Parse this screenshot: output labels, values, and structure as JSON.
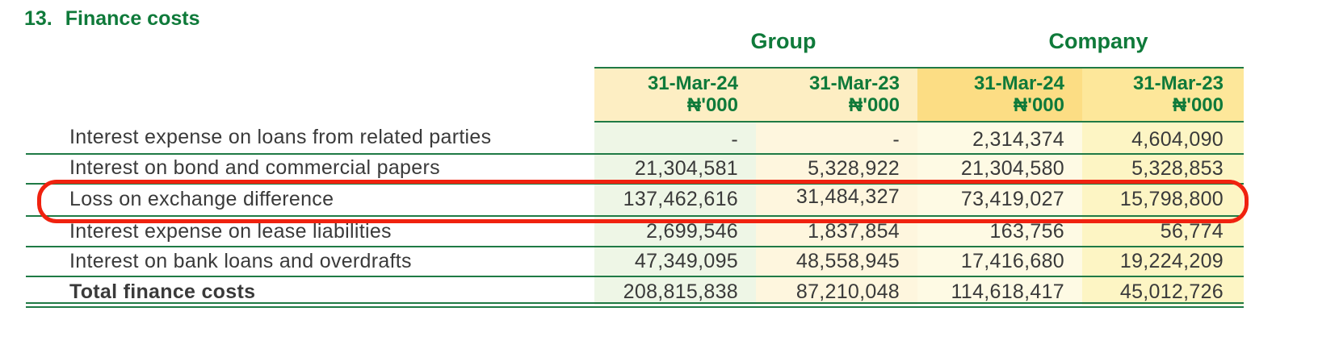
{
  "section": {
    "number": "13.",
    "title": "Finance costs"
  },
  "groups": [
    {
      "label": "Group"
    },
    {
      "label": "Company"
    }
  ],
  "columns": [
    {
      "date": "31-Mar-24",
      "unit": "₦'000"
    },
    {
      "date": "31-Mar-23",
      "unit": "₦'000"
    },
    {
      "date": "31-Mar-24",
      "unit": "₦'000"
    },
    {
      "date": "31-Mar-23",
      "unit": "₦'000"
    }
  ],
  "rows": [
    {
      "label": "Interest expense on loans from related parties",
      "values": [
        "-",
        "-",
        "2,314,374",
        "4,604,090"
      ]
    },
    {
      "label": "Interest on bond and commercial papers",
      "values": [
        "21,304,581",
        "5,328,922",
        "21,304,580",
        "5,328,853"
      ]
    },
    {
      "label": "Loss on exchange difference",
      "values": [
        "137,462,616",
        "31,484,327",
        "73,419,027",
        "15,798,800"
      ]
    },
    {
      "label": "Interest expense on lease liabilities",
      "values": [
        "2,699,546",
        "1,837,854",
        "163,756",
        "56,774"
      ]
    },
    {
      "label": "Interest on bank loans and overdrafts",
      "values": [
        "47,349,095",
        "48,558,945",
        "17,416,680",
        "19,224,209"
      ]
    },
    {
      "label": "Total finance costs",
      "values": [
        "208,815,838",
        "87,210,048",
        "114,618,417",
        "45,012,726"
      ]
    }
  ],
  "colors": {
    "accent_green": "#0f7a3a",
    "highlight_red": "#f0220f",
    "group_24_header": "#fdeec3",
    "group_24_body": "#eef6e6",
    "group_23_header": "#fdeec3",
    "group_23_body": "#fef6de",
    "company_24_header": "#fcdd84",
    "company_24_body": "#fefae4",
    "company_23_header": "#fde79a",
    "company_23_body": "#fdf5c4"
  }
}
